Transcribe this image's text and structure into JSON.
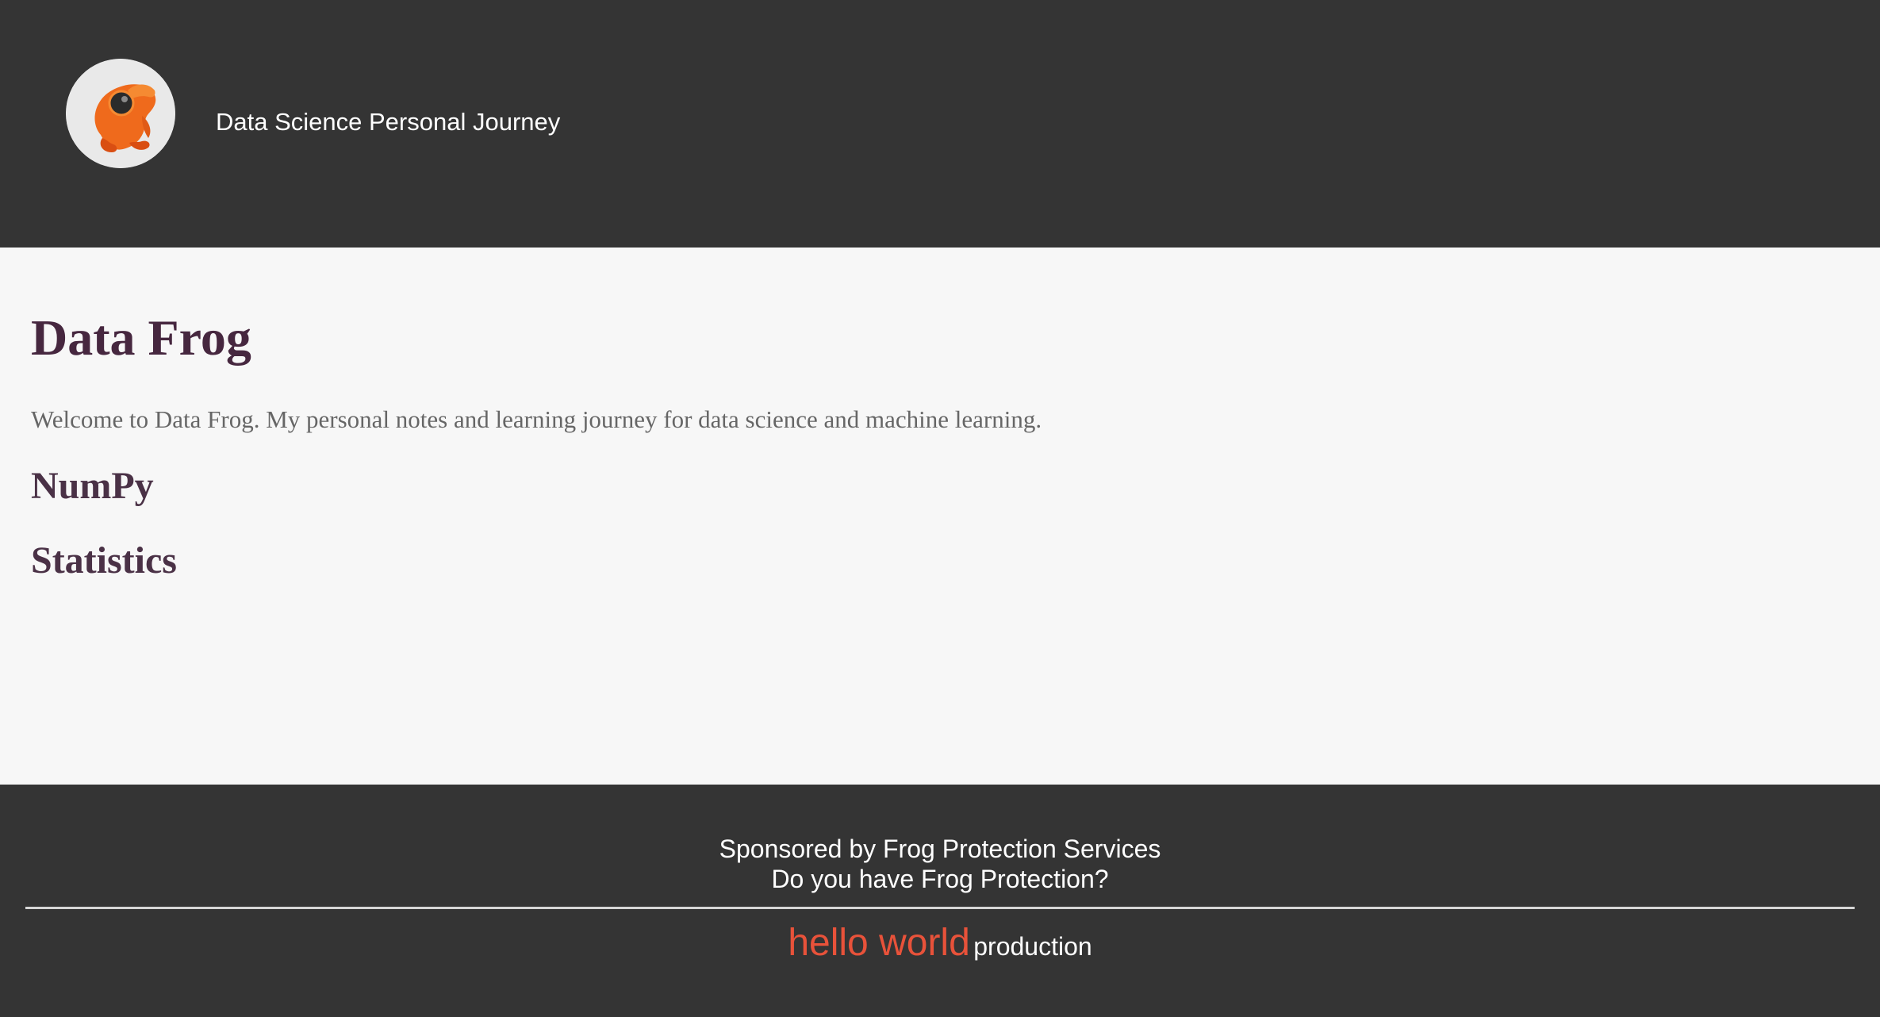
{
  "header": {
    "logo_icon": "frog-logo-icon",
    "site_title": "Data Science Personal Journey",
    "background_color": "#343434"
  },
  "main": {
    "title": "Data Frog",
    "intro": "Welcome to Data Frog. My personal notes and learning journey for data science and machine learning.",
    "sections": [
      {
        "label": "NumPy"
      },
      {
        "label": "Statistics"
      }
    ],
    "title_color": "#46273f"
  },
  "footer": {
    "sponsor_line_1": "Sponsored by Frog Protection Services",
    "sponsor_line_2": "Do you have Frog Protection?",
    "credit_brand": "hello world",
    "credit_suffix": "production",
    "brand_color": "#e8523a"
  }
}
